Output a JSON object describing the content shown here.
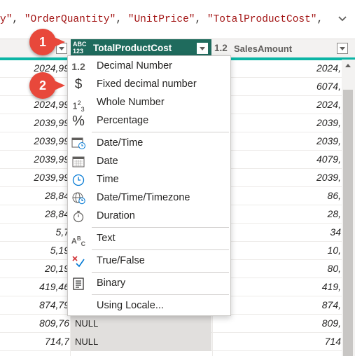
{
  "formula": {
    "parts": [
      "y\"",
      ", ",
      "\"OrderQuantity\"",
      ", ",
      "\"UnitPrice\"",
      ", ",
      "\"TotalProductCost\"",
      ","
    ]
  },
  "header": {
    "left_col_dropdown": "",
    "active_col": {
      "type_icon_top": "ABC",
      "type_icon_bottom": "123",
      "name": "TotalProductCost"
    },
    "sales_col": {
      "type_icon": "1.2",
      "name": "SalesAmount"
    }
  },
  "rows": [
    {
      "left": "2024,99",
      "right": "2024,"
    },
    {
      "left": "",
      "right": "6074,"
    },
    {
      "left": "2024,99",
      "right": "2024,"
    },
    {
      "left": "2039,99",
      "right": "2039,"
    },
    {
      "left": "2039,99",
      "right": "2039,"
    },
    {
      "left": "2039,99",
      "right": "4079,"
    },
    {
      "left": "2039,99",
      "right": "2039,"
    },
    {
      "left": "28,84",
      "right": "86,"
    },
    {
      "left": "28,84",
      "right": "28,"
    },
    {
      "left": "5,7",
      "right": "34"
    },
    {
      "left": "5,19",
      "right": "10,"
    },
    {
      "left": "20,19",
      "right": "80,"
    },
    {
      "left": "419,46",
      "right": "419,"
    },
    {
      "left": "874,79",
      "right": "874,"
    },
    {
      "left": "809,76",
      "mid": "NULL",
      "right": "809,"
    },
    {
      "left": "714,7",
      "mid": "NULL",
      "right": "714"
    }
  ],
  "menu": {
    "items": [
      {
        "icon": "1.2",
        "label": "Decimal Number"
      },
      {
        "icon": "$",
        "label": "Fixed decimal number"
      },
      {
        "icon": "1²3",
        "label": "Whole Number"
      },
      {
        "icon": "%",
        "label": "Percentage"
      },
      {
        "icon": "calendar-clock-icon",
        "label": "Date/Time"
      },
      {
        "icon": "calendar-icon",
        "label": "Date"
      },
      {
        "icon": "clock-icon",
        "label": "Time"
      },
      {
        "icon": "globe-clock-icon",
        "label": "Date/Time/Timezone"
      },
      {
        "icon": "stopwatch-icon",
        "label": "Duration"
      },
      {
        "icon": "ABC",
        "label": "Text"
      },
      {
        "icon": "true-false-icon",
        "label": "True/False"
      },
      {
        "icon": "binary-icon",
        "label": "Binary"
      },
      {
        "icon": "",
        "label": "Using Locale..."
      }
    ]
  },
  "badges": {
    "one": "1",
    "two": "2"
  },
  "colors": {
    "accent": "#0bb5a5",
    "active_header": "#1f6b5d",
    "badge": "#e8483b"
  }
}
